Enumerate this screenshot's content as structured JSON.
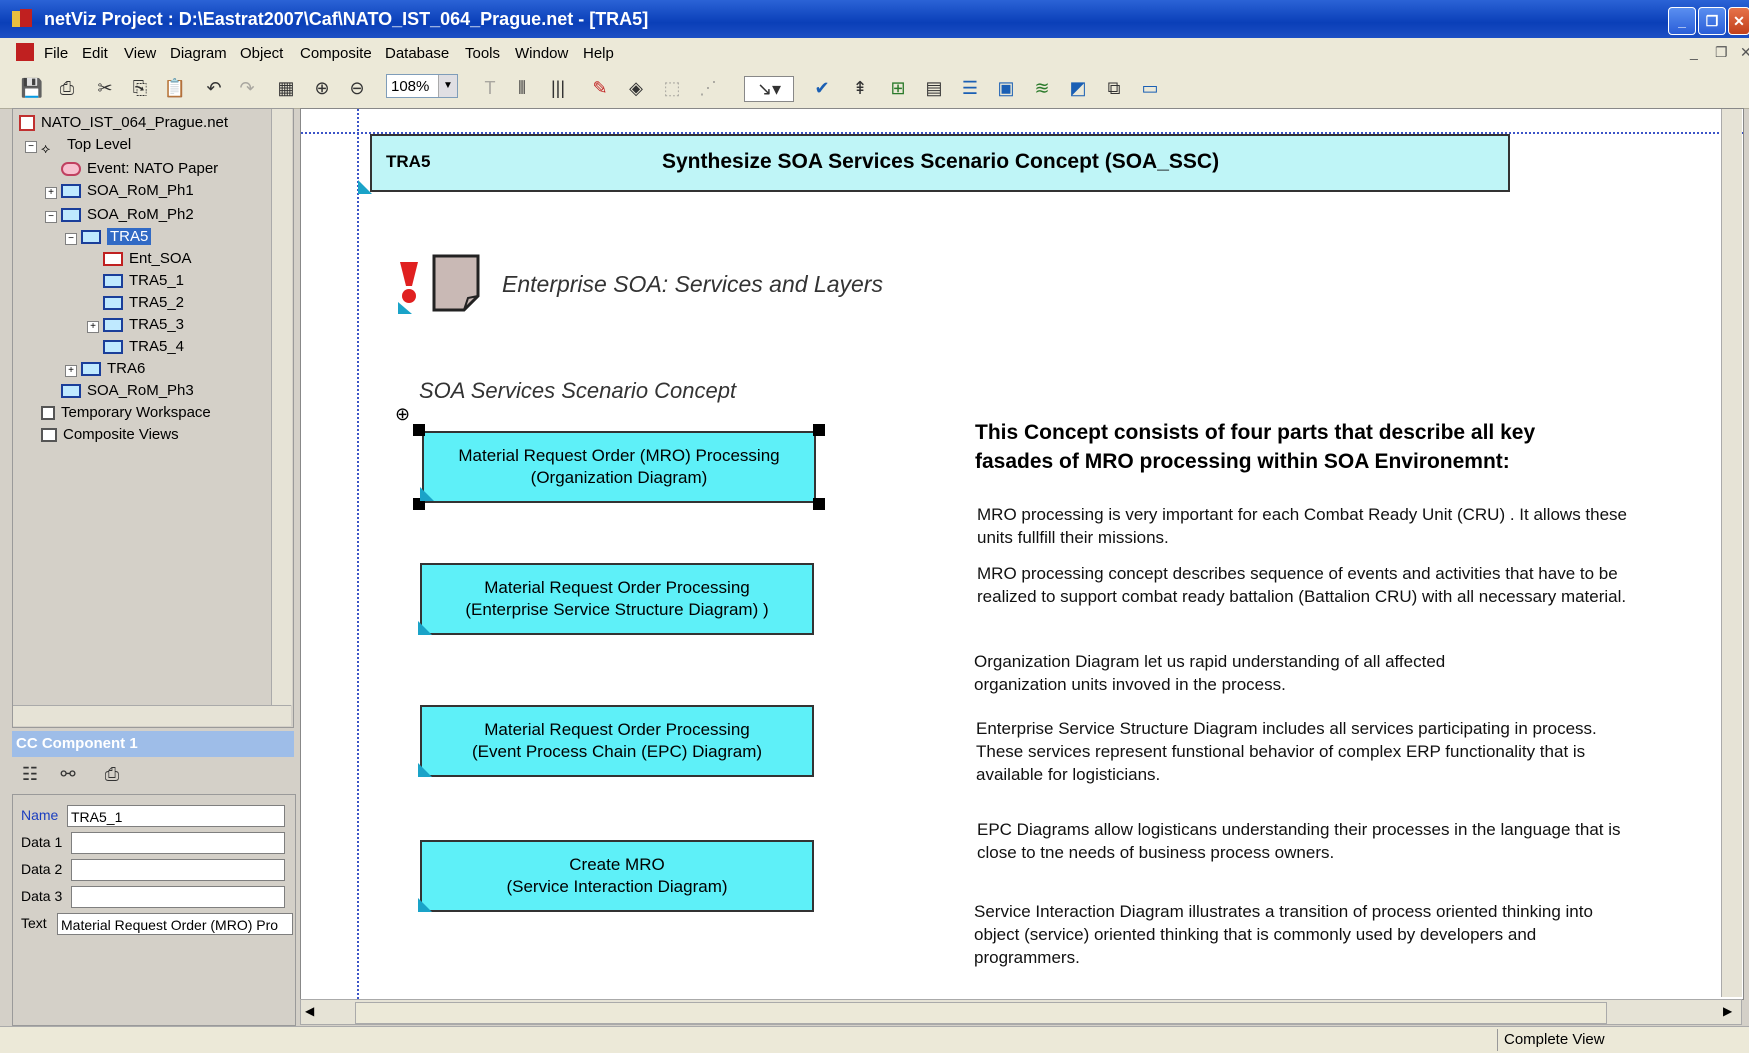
{
  "window": {
    "title": "netViz Project : D:\\Eastrat2007\\Caf\\NATO_IST_064_Prague.net - [TRA5]",
    "controls": [
      "minimize",
      "restore",
      "close"
    ]
  },
  "menubar": [
    "File",
    "Edit",
    "View",
    "Diagram",
    "Object",
    "Composite",
    "Database",
    "Tools",
    "Window",
    "Help"
  ],
  "toolbar": {
    "zoom": "108%"
  },
  "tree": {
    "root": "NATO_IST_064_Prague.net",
    "items": [
      {
        "label": "Top Level"
      },
      {
        "label": "Event: NATO Paper"
      },
      {
        "label": "SOA_RoM_Ph1"
      },
      {
        "label": "SOA_RoM_Ph2"
      },
      {
        "label": "TRA5"
      },
      {
        "label": "Ent_SOA"
      },
      {
        "label": "TRA5_1"
      },
      {
        "label": "TRA5_2"
      },
      {
        "label": "TRA5_3"
      },
      {
        "label": "TRA5_4"
      },
      {
        "label": "TRA6"
      },
      {
        "label": "SOA_RoM_Ph3"
      },
      {
        "label": "Temporary Workspace"
      },
      {
        "label": "Composite Views"
      }
    ]
  },
  "component_panel": {
    "header": "CC Component 1",
    "fields": [
      {
        "label": "Name",
        "value": "TRA5_1"
      },
      {
        "label": "Data 1",
        "value": ""
      },
      {
        "label": "Data 2",
        "value": ""
      },
      {
        "label": "Data 3",
        "value": ""
      },
      {
        "label": "Text",
        "value": "Material Request Order (MRO) Pro"
      }
    ]
  },
  "canvas": {
    "header_id": "TRA5",
    "header_title": "Synthesize SOA Services Scenario Concept  (SOA_SSC)",
    "enterprise_label": "Enterprise SOA: Services and  Layers",
    "scenario_label": "SOA Services Scenario Concept",
    "boxes": [
      {
        "line1": "Material Request Order (MRO) Processing",
        "line2": "(Organization Diagram)"
      },
      {
        "line1": "Material Request Order Processing",
        "line2": "(Enterprise Service Structure Diagram) )"
      },
      {
        "line1": "Material Request Order Processing",
        "line2": "(Event Process Chain (EPC) Diagram)"
      },
      {
        "line1": "Create MRO",
        "line2": "(Service Interaction Diagram)"
      }
    ],
    "concept_title": "This Concept consists of four parts that describe all key fasades of MRO processing within SOA Environemnt:",
    "descriptions": [
      "MRO processing is very important for each Combat Ready Unit (CRU) . It allows these units fullfill their missions.",
      "MRO processing concept describes sequence of events and activities that have to be realized to support combat ready battalion (Battalion CRU) with all necessary material.",
      "Organization Diagram let us rapid understanding of all affected organization units invoved in the process.",
      "Enterprise Service Structure Diagram includes all services participating in process. These services represent funstional behavior of complex ERP functionality that is available for logisticians.",
      "EPC Diagrams allow logisticans understanding their processes in the language that is close to tne needs of business process owners.",
      "Service Interaction Diagram illustrates a transition of process oriented thinking into object (service) oriented thinking that is commonly used by developers and programmers."
    ]
  },
  "status": {
    "view": "Complete View"
  }
}
